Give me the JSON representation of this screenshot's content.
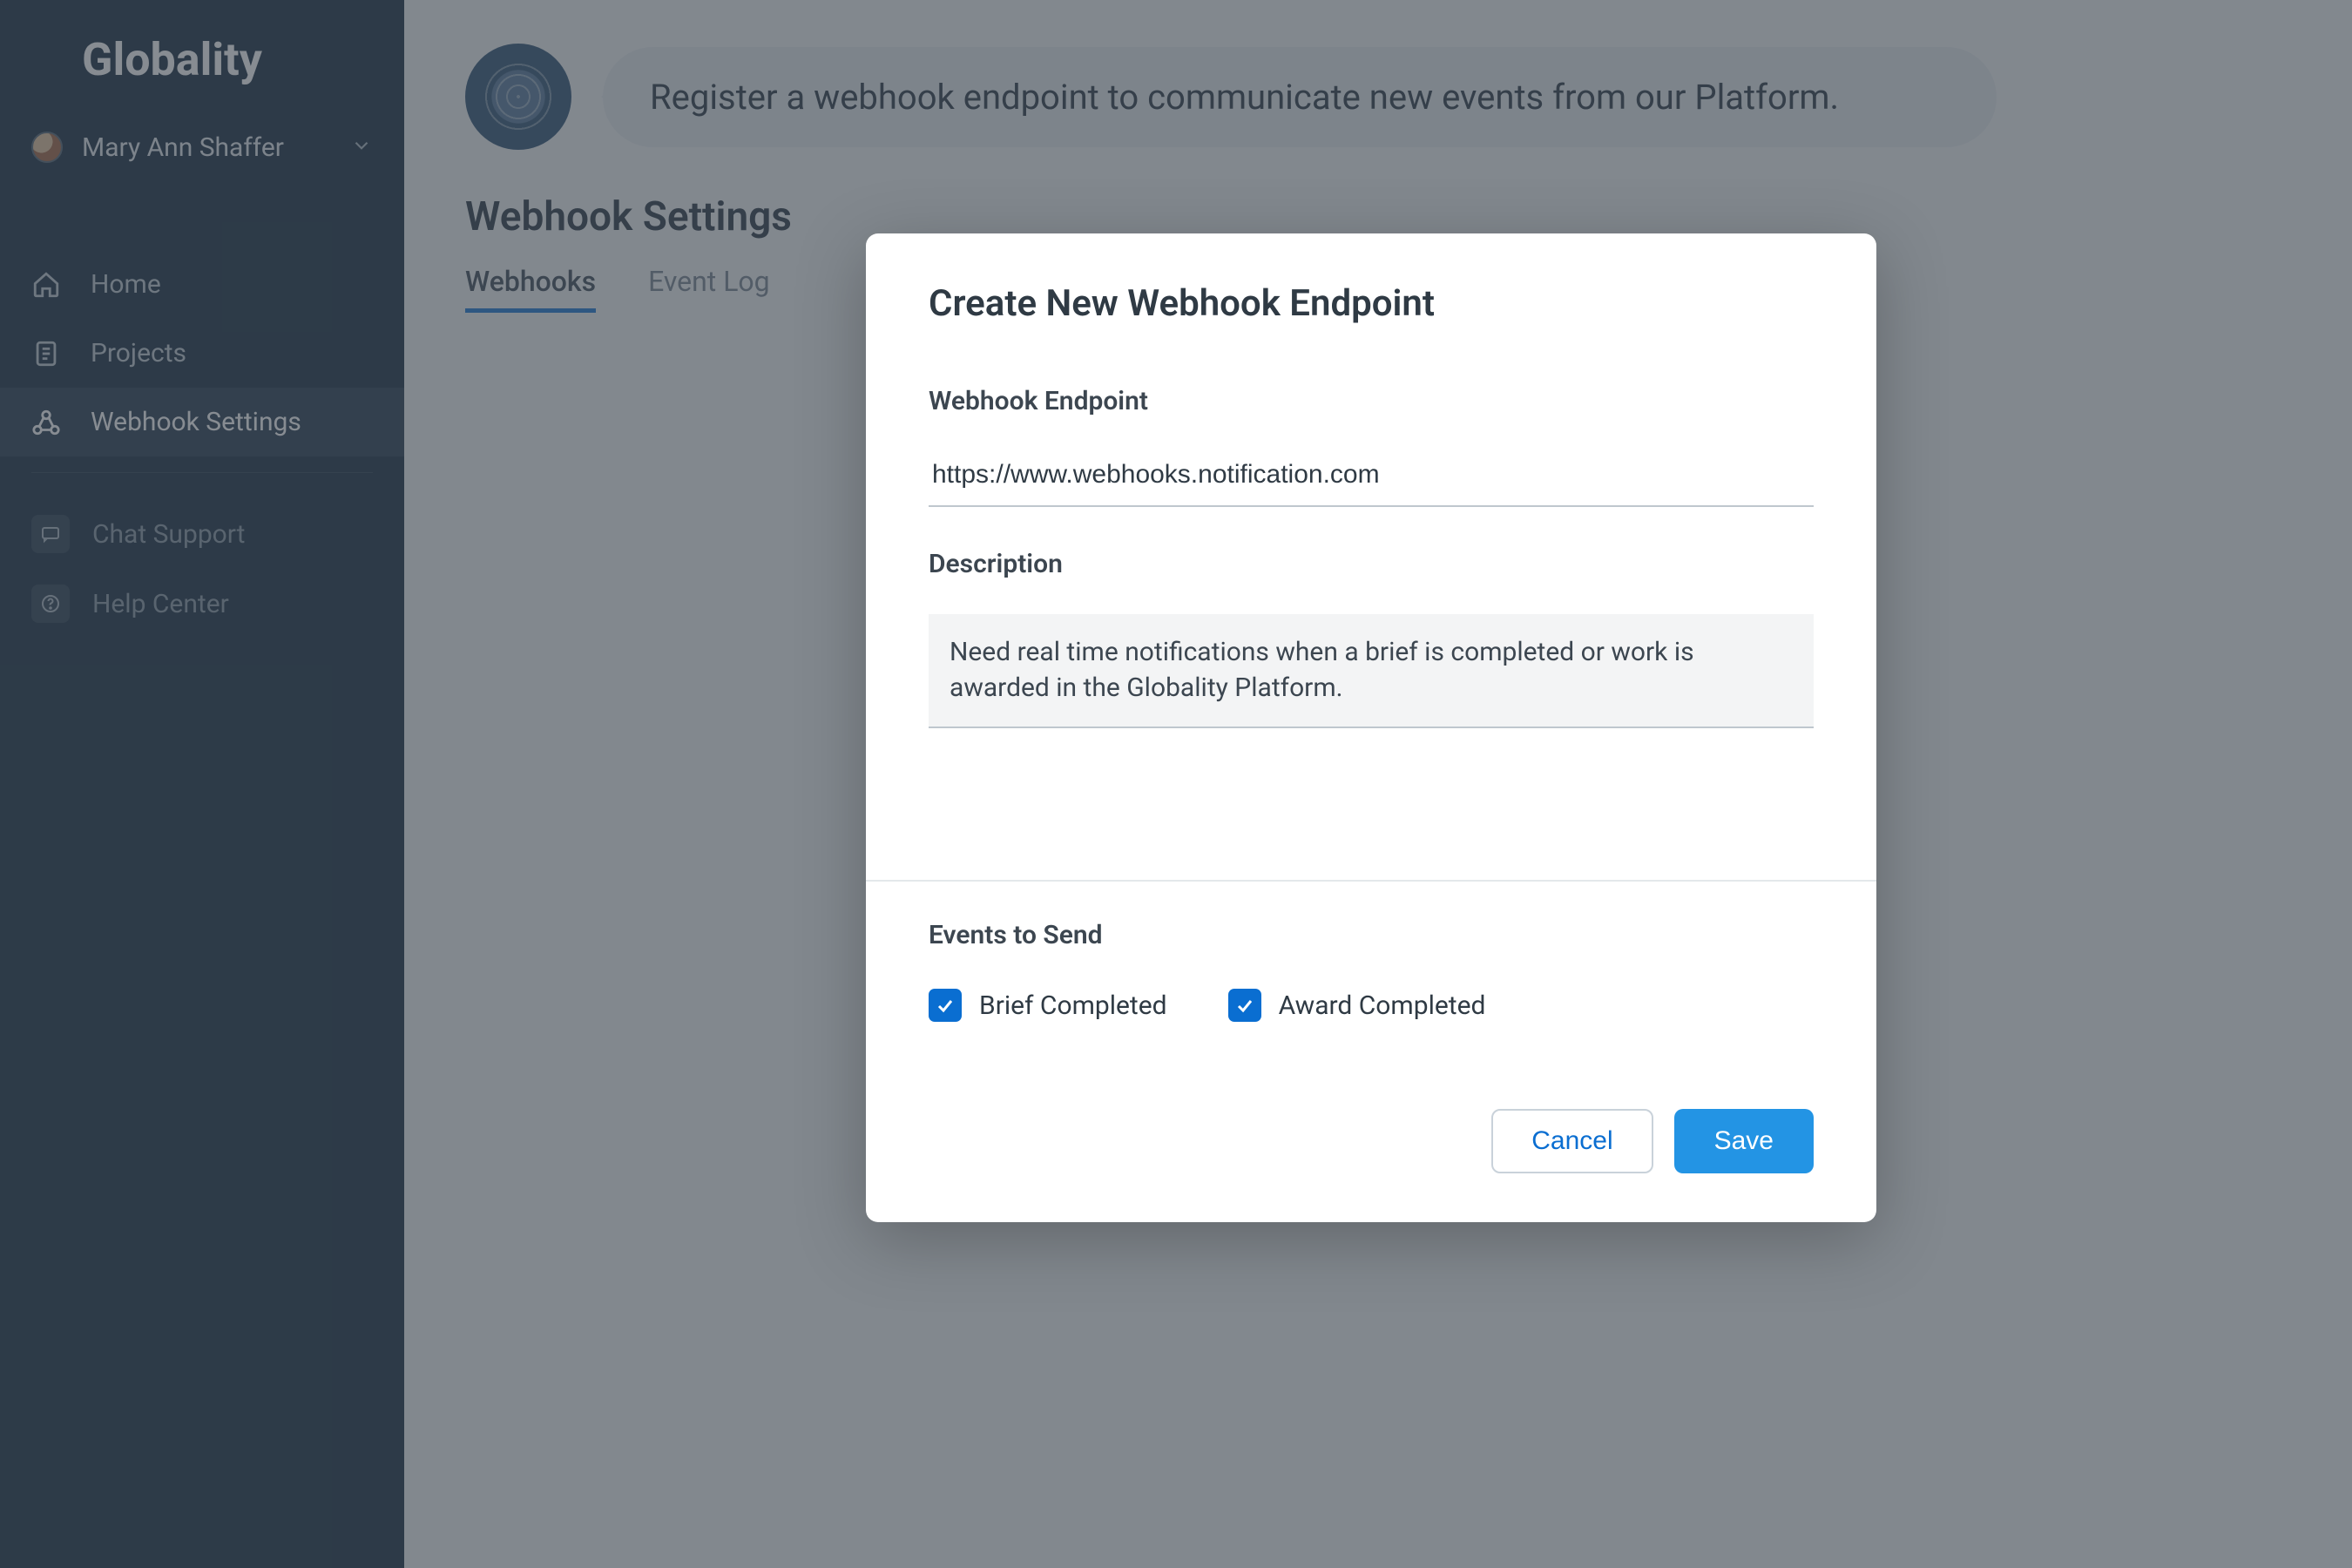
{
  "brand": "Globality",
  "user": {
    "name": "Mary Ann Shaffer"
  },
  "nav": {
    "items": [
      {
        "label": "Home"
      },
      {
        "label": "Projects"
      },
      {
        "label": "Webhook Settings"
      }
    ]
  },
  "support": {
    "items": [
      {
        "label": "Chat Support"
      },
      {
        "label": "Help Center"
      }
    ]
  },
  "hero": {
    "text": "Register a webhook endpoint to communicate new events from our Platform."
  },
  "page": {
    "title": "Webhook Settings",
    "tabs": [
      {
        "label": "Webhooks"
      },
      {
        "label": "Event Log"
      }
    ]
  },
  "modal": {
    "title": "Create New Webhook Endpoint",
    "endpoint_label": "Webhook Endpoint",
    "endpoint_value": "https://www.webhooks.notification.com",
    "description_label": "Description",
    "description_value": "Need real time notifications when a brief is completed or work is awarded in the Globality Platform.",
    "events_label": "Events to Send",
    "events": [
      {
        "label": "Brief Completed",
        "checked": true
      },
      {
        "label": "Award Completed",
        "checked": true
      }
    ],
    "cancel_label": "Cancel",
    "save_label": "Save"
  }
}
